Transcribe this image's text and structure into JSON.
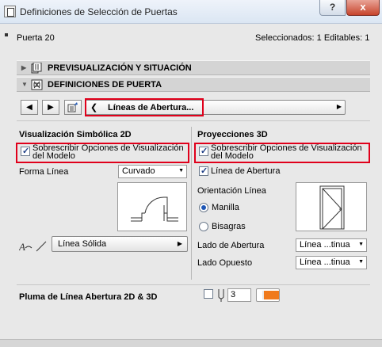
{
  "window": {
    "title": "Definiciones de Selección de Puertas",
    "help": "?",
    "close": "x"
  },
  "header": {
    "element": "Puerta 20",
    "selection_info": "Seleccionados: 1 Editables: 1"
  },
  "panels": [
    {
      "label": "PREVISUALIZACIÓN Y SITUACIÓN"
    },
    {
      "label": "DEFINICIONES DE PUERTA"
    }
  ],
  "nav": {
    "page": "Líneas de Abertura..."
  },
  "left": {
    "title": "Visualización Simbólica 2D",
    "override_label": "Sobrescribir Opciones de Visualización del Modelo",
    "override_checked": true,
    "line_shape_label": "Forma Línea",
    "line_shape_value": "Curvado",
    "line_type_value": "Línea Sólida"
  },
  "right": {
    "title": "Proyecciones 3D",
    "override_label": "Sobrescribir Opciones de Visualización del Modelo",
    "override_checked": true,
    "opening_line_label": "Línea de Abertura",
    "opening_line_checked": true,
    "orientation_label": "Orientación Línea",
    "orientation_options": [
      "Manilla",
      "Bisagras"
    ],
    "orientation_selected": "Manilla",
    "opening_side_label": "Lado de Abertura",
    "opening_side_value": "Línea ...tinua",
    "opposite_side_label": "Lado Opuesto",
    "opposite_side_value": "Línea ...tinua"
  },
  "pen": {
    "label": "Pluma de Línea Abertura 2D & 3D",
    "value": "3",
    "color": "#f07a1c"
  }
}
